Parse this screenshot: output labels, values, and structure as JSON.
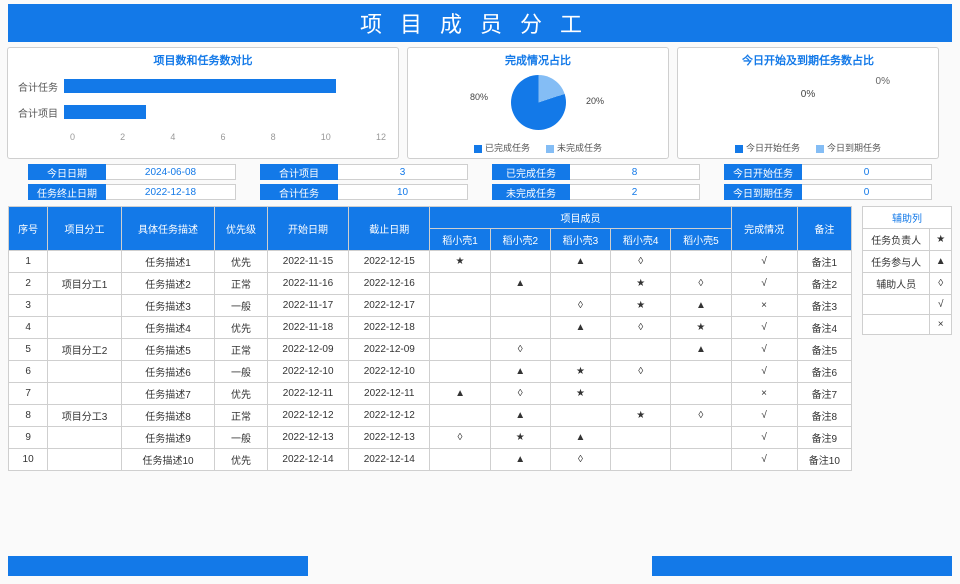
{
  "title": "项目成员分工",
  "chart1": {
    "title": "项目数和任务数对比",
    "rows": [
      {
        "label": "合计任务",
        "value": 10
      },
      {
        "label": "合计项目",
        "value": 3
      }
    ],
    "axis": [
      "0",
      "2",
      "4",
      "6",
      "8",
      "10",
      "12"
    ],
    "max": 12
  },
  "chart2": {
    "title": "完成情况占比",
    "complete_pct": "80%",
    "incomplete_pct": "20%",
    "legend": [
      "已完成任务",
      "未完成任务"
    ]
  },
  "chart3": {
    "title": "今日开始及到期任务数占比",
    "start_pct": "0%",
    "due_pct": "0%",
    "legend": [
      "今日开始任务",
      "今日到期任务"
    ]
  },
  "stats": [
    [
      {
        "lab": "今日日期",
        "val": "2024-06-08"
      },
      {
        "lab": "任务终止日期",
        "val": "2022-12-18"
      }
    ],
    [
      {
        "lab": "合计项目",
        "val": "3"
      },
      {
        "lab": "合计任务",
        "val": "10"
      }
    ],
    [
      {
        "lab": "已完成任务",
        "val": "8"
      },
      {
        "lab": "未完成任务",
        "val": "2"
      }
    ],
    [
      {
        "lab": "今日开始任务",
        "val": "0"
      },
      {
        "lab": "今日到期任务",
        "val": "0"
      }
    ]
  ],
  "table": {
    "head": {
      "seq": "序号",
      "proj": "项目分工",
      "desc": "具体任务描述",
      "prio": "优先级",
      "start": "开始日期",
      "end": "截止日期",
      "members": "项目成员",
      "m": [
        "稻小壳1",
        "稻小壳2",
        "稻小壳3",
        "稻小壳4",
        "稻小壳5"
      ],
      "done": "完成情况",
      "note": "备注"
    },
    "rows": [
      {
        "seq": "1",
        "proj": "",
        "desc": "任务描述1",
        "prio": "优先",
        "start": "2022-11-15",
        "end": "2022-12-15",
        "m": [
          "★",
          "",
          "▲",
          "◊",
          ""
        ],
        "done": "√",
        "note": "备注1"
      },
      {
        "seq": "2",
        "proj": "项目分工1",
        "desc": "任务描述2",
        "prio": "正常",
        "start": "2022-11-16",
        "end": "2022-12-16",
        "m": [
          "",
          "▲",
          "",
          "★",
          "◊"
        ],
        "done": "√",
        "note": "备注2"
      },
      {
        "seq": "3",
        "proj": "",
        "desc": "任务描述3",
        "prio": "一般",
        "start": "2022-11-17",
        "end": "2022-12-17",
        "m": [
          "",
          "",
          "◊",
          "★",
          "▲"
        ],
        "done": "×",
        "note": "备注3"
      },
      {
        "seq": "4",
        "proj": "",
        "desc": "任务描述4",
        "prio": "优先",
        "start": "2022-11-18",
        "end": "2022-12-18",
        "m": [
          "",
          "",
          "▲",
          "◊",
          "★"
        ],
        "done": "√",
        "note": "备注4"
      },
      {
        "seq": "5",
        "proj": "项目分工2",
        "desc": "任务描述5",
        "prio": "正常",
        "start": "2022-12-09",
        "end": "2022-12-09",
        "m": [
          "",
          "◊",
          "",
          "",
          "▲"
        ],
        "done": "√",
        "note": "备注5"
      },
      {
        "seq": "6",
        "proj": "",
        "desc": "任务描述6",
        "prio": "一般",
        "start": "2022-12-10",
        "end": "2022-12-10",
        "m": [
          "",
          "▲",
          "★",
          "◊",
          ""
        ],
        "done": "√",
        "note": "备注6"
      },
      {
        "seq": "7",
        "proj": "",
        "desc": "任务描述7",
        "prio": "优先",
        "start": "2022-12-11",
        "end": "2022-12-11",
        "m": [
          "▲",
          "◊",
          "★",
          "",
          ""
        ],
        "done": "×",
        "note": "备注7"
      },
      {
        "seq": "8",
        "proj": "项目分工3",
        "desc": "任务描述8",
        "prio": "正常",
        "start": "2022-12-12",
        "end": "2022-12-12",
        "m": [
          "",
          "▲",
          "",
          "★",
          "◊"
        ],
        "done": "√",
        "note": "备注8"
      },
      {
        "seq": "9",
        "proj": "",
        "desc": "任务描述9",
        "prio": "一般",
        "start": "2022-12-13",
        "end": "2022-12-13",
        "m": [
          "◊",
          "★",
          "▲",
          "",
          ""
        ],
        "done": "√",
        "note": "备注9"
      },
      {
        "seq": "10",
        "proj": "",
        "desc": "任务描述10",
        "prio": "优先",
        "start": "2022-12-14",
        "end": "2022-12-14",
        "m": [
          "",
          "▲",
          "◊",
          "",
          ""
        ],
        "done": "√",
        "note": "备注10"
      }
    ]
  },
  "aux": {
    "title": "辅助列",
    "rows": [
      {
        "lab": "任务负责人",
        "sym": "★"
      },
      {
        "lab": "任务参与人",
        "sym": "▲"
      },
      {
        "lab": "辅助人员",
        "sym": "◊"
      },
      {
        "lab": "",
        "sym": "√"
      },
      {
        "lab": "",
        "sym": "×"
      }
    ]
  },
  "chart_data": [
    {
      "type": "bar",
      "orientation": "horizontal",
      "title": "项目数和任务数对比",
      "categories": [
        "合计任务",
        "合计项目"
      ],
      "values": [
        10,
        3
      ],
      "xlim": [
        0,
        12
      ]
    },
    {
      "type": "pie",
      "title": "完成情况占比",
      "series": [
        {
          "name": "已完成任务",
          "value": 80
        },
        {
          "name": "未完成任务",
          "value": 20
        }
      ]
    },
    {
      "type": "pie",
      "title": "今日开始及到期任务数占比",
      "series": [
        {
          "name": "今日开始任务",
          "value": 0
        },
        {
          "name": "今日到期任务",
          "value": 0
        }
      ]
    }
  ]
}
